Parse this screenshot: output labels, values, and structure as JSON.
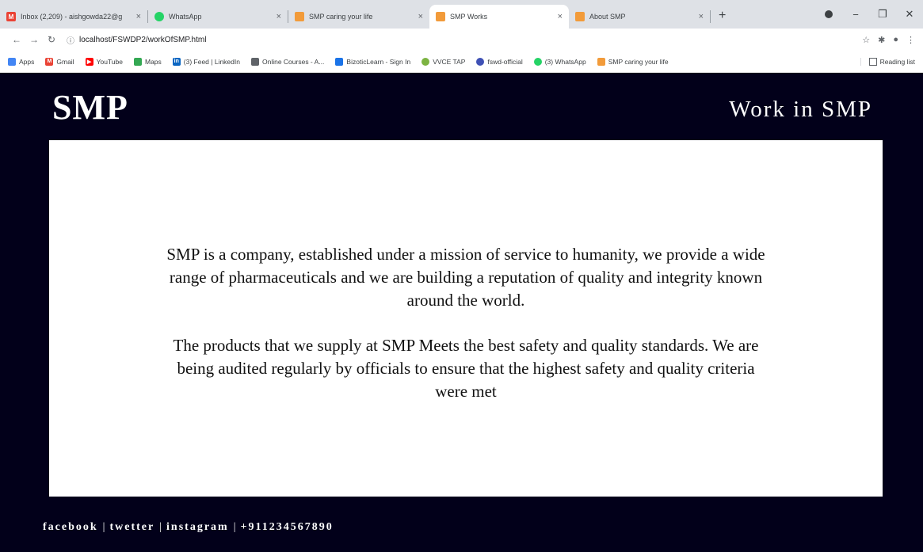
{
  "browser": {
    "tabs": [
      {
        "title": "Inbox (2,209) - aishgowda22@g",
        "favicon": "gmail-icon",
        "color": "#ea4335",
        "active": false
      },
      {
        "title": "WhatsApp",
        "favicon": "whatsapp-icon",
        "color": "#25d366",
        "active": false
      },
      {
        "title": "SMP caring your life",
        "favicon": "smp-icon",
        "color": "#f29b3a",
        "active": false
      },
      {
        "title": "SMP Works",
        "favicon": "smp-icon",
        "color": "#f29b3a",
        "active": true
      },
      {
        "title": "About SMP",
        "favicon": "smp-icon",
        "color": "#f29b3a",
        "active": false
      }
    ],
    "tab_close_glyph": "×",
    "new_tab_glyph": "+",
    "url": "localhost/FSWDP2/workOfSMP.html",
    "bookmarks": [
      {
        "label": "Apps",
        "icon": "apps-grid-icon",
        "color": "#4285f4"
      },
      {
        "label": "Gmail",
        "icon": "gmail-icon",
        "color": "#ea4335"
      },
      {
        "label": "YouTube",
        "icon": "youtube-icon",
        "color": "#ff0000"
      },
      {
        "label": "Maps",
        "icon": "maps-icon",
        "color": "#34a853"
      },
      {
        "label": "(3) Feed | LinkedIn",
        "icon": "linkedin-icon",
        "color": "#0a66c2"
      },
      {
        "label": "Online Courses - A...",
        "icon": "courses-icon",
        "color": "#5f6368"
      },
      {
        "label": "BizoticLearn - Sign In",
        "icon": "bizotic-icon",
        "color": "#1a73e8"
      },
      {
        "label": "VVCE TAP",
        "icon": "vvce-icon",
        "color": "#7cb342"
      },
      {
        "label": "fswd-official",
        "icon": "fswd-icon",
        "color": "#3f51b5"
      },
      {
        "label": "(3) WhatsApp",
        "icon": "whatsapp-icon",
        "color": "#25d366"
      },
      {
        "label": "SMP caring your life",
        "icon": "smp-icon",
        "color": "#f29b3a"
      }
    ],
    "reading_list": "Reading list"
  },
  "page": {
    "brand": "SMP",
    "header_title": "Work in SMP",
    "paragraphs": [
      "SMP is a company, established under a mission of service to humanity, we provide a wide range of pharmaceuticals and we are building a reputation of quality and integrity known around the world.",
      "The products that we supply at SMP Meets the best safety and quality standards. We are being audited regularly by officials to ensure that the highest safety and quality criteria were met"
    ],
    "footer": {
      "facebook": "facebook",
      "twitter": "twetter",
      "instagram": "instagram",
      "phone": "+911234567890",
      "separator": "|"
    },
    "colors": {
      "background": "#02001a",
      "panel": "#ffffff"
    }
  }
}
